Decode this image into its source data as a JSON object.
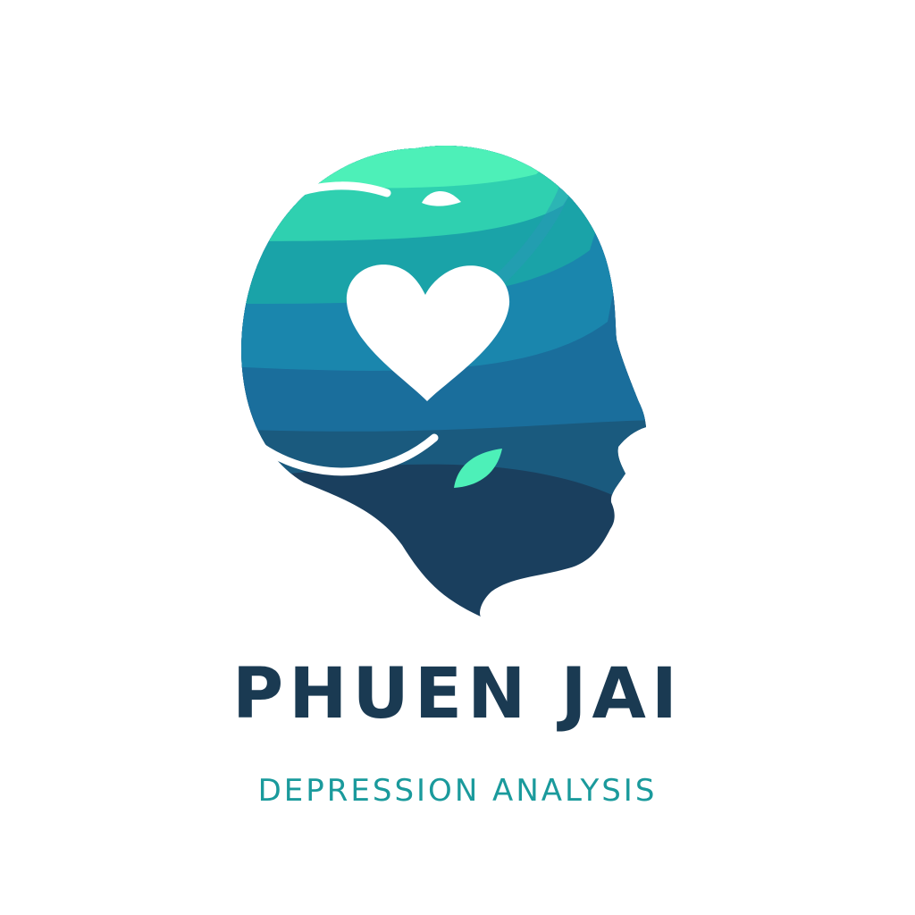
{
  "brand": {
    "name": "PHUEN JAI",
    "tagline": "DEPRESSION ANALYSIS"
  },
  "logo": {
    "icon": "head-profile-with-heart-icon",
    "elements": [
      "head-silhouette",
      "wave-bands",
      "heart-icon",
      "crescent-ring",
      "leaf-icon"
    ]
  },
  "colors": {
    "name_text": "#1a3a52",
    "tagline_text": "#1a9a9c",
    "mint": "#4df0b8",
    "teal": "#1aa3a8",
    "blue": "#1a6e9c",
    "navy": "#1a3f5e",
    "white": "#ffffff"
  }
}
